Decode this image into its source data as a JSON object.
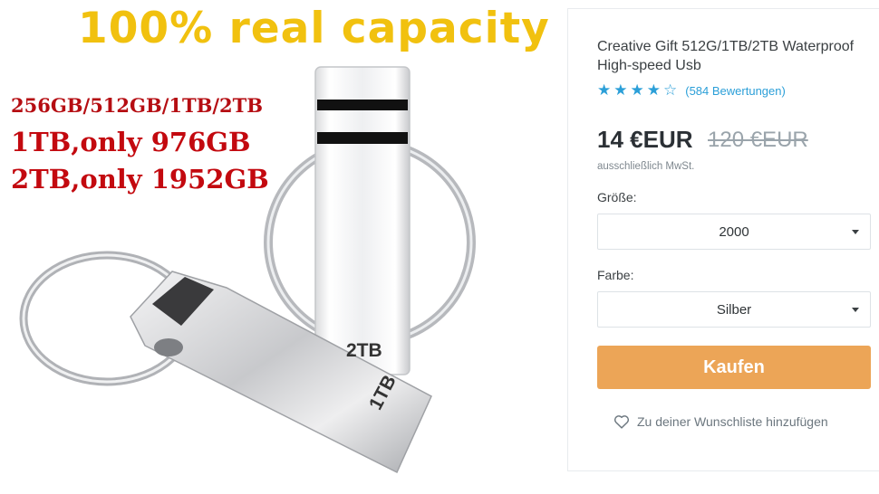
{
  "image": {
    "headline": "100% real capacity",
    "capacities": "256GB/512GB/1TB/2TB",
    "note_1tb": "1TB,only 976GB",
    "note_2tb": "2TB,only 1952GB",
    "engraving_2tb": "2TB",
    "engraving_1tb": "1TB"
  },
  "product": {
    "title": "Creative Gift 512G/1TB/2TB Waterproof High-speed Usb",
    "rating": {
      "stars": 4,
      "max_stars": 5,
      "reviews": "(584 Bewertungen)"
    },
    "price": "14 €EUR",
    "old_price": "120 €EUR",
    "vat": "ausschließlich MwSt."
  },
  "options": {
    "size_label": "Größe:",
    "size_value": "2000",
    "color_label": "Farbe:",
    "color_value": "Silber"
  },
  "actions": {
    "buy_label": "Kaufen",
    "wishlist_label": "Zu deiner Wunschliste hinzufügen"
  },
  "colors": {
    "accent_blue": "#2b9fd8",
    "buy_orange": "#eca557",
    "headline_yellow": "#f1c10f",
    "text_red": "#c3090f"
  }
}
